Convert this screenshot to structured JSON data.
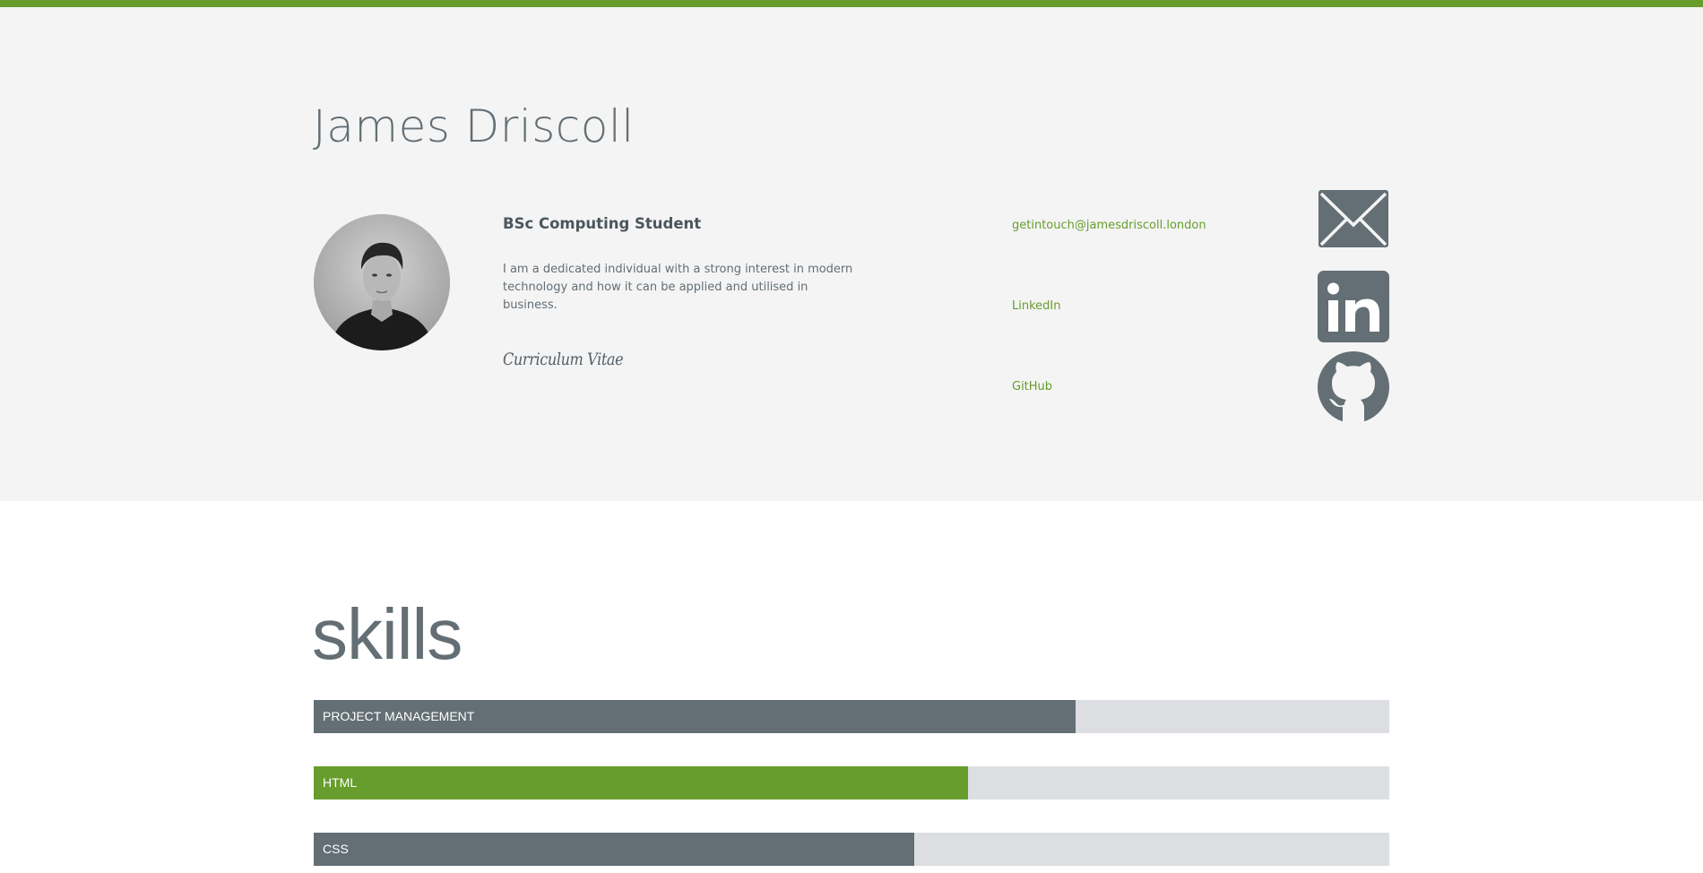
{
  "header": {
    "name": "James Driscoll"
  },
  "profile": {
    "role": "BSc Computing Student",
    "bio": "I am a dedicated individual with a strong interest in modern technology and how it can be applied and utilised in business.",
    "cv_link": "Curriculum Vitae"
  },
  "contacts": {
    "email": {
      "label": "getintouch@jamesdriscoll.london",
      "icon": "envelope-icon"
    },
    "linkedin": {
      "label": "LinkedIn",
      "icon": "linkedin-icon"
    },
    "github": {
      "label": "GitHub",
      "icon": "github-icon"
    }
  },
  "skills": {
    "title": "skills",
    "items": [
      {
        "label": "Project Management",
        "level": 0.708,
        "color": "#636e75"
      },
      {
        "label": "HTML",
        "level": 0.608,
        "color": "#679d2c"
      },
      {
        "label": "CSS",
        "level": 0.558,
        "color": "#636e75"
      }
    ]
  },
  "colors": {
    "accent": "#679d2c",
    "slate": "#636e75",
    "hero_background": "#f4f4f4",
    "track": "#dcdee1"
  }
}
